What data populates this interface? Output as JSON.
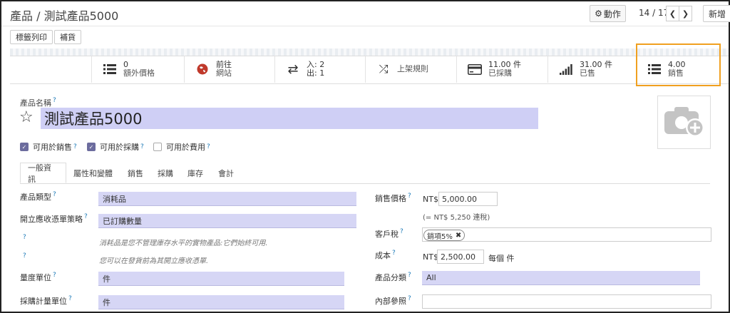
{
  "header": {
    "breadcrumb_root": "產品",
    "breadcrumb_sep": "/",
    "breadcrumb_current": "測試產品5000",
    "action_label": "動作",
    "pager": "14 / 17",
    "new_label": "新增"
  },
  "toolbar": {
    "print_labels": "標籤列印",
    "replenish": "補貨"
  },
  "smart_buttons": [
    {
      "icon": "list-icon",
      "line1": "0",
      "line2": "額外價格"
    },
    {
      "icon": "globe-icon",
      "line1": "前往",
      "line2": "網站"
    },
    {
      "icon": "transfer-icon",
      "line1": "入: 2",
      "line2": "出: 1"
    },
    {
      "icon": "shuffle-icon",
      "line1": "",
      "line2": "上架規則"
    },
    {
      "icon": "credit-card-icon",
      "line1": "11.00 件",
      "line2": "已採購"
    },
    {
      "icon": "signal-icon",
      "line1": "31.00 件",
      "line2": "已售"
    },
    {
      "icon": "list-icon",
      "line1": "4.00",
      "line2": "銷售"
    }
  ],
  "product": {
    "name_label": "產品名稱",
    "name_value": "測試產品5000",
    "can_be_sold": "可用於銷售",
    "can_be_purchased": "可用於採購",
    "can_be_expensed": "可用於費用"
  },
  "tabs": [
    "一般資訊",
    "屬性和變體",
    "銷售",
    "採購",
    "庫存",
    "會計"
  ],
  "left_fields": {
    "product_type_label": "產品類型",
    "product_type_value": "消耗品",
    "invoice_policy_label": "開立應收憑單策略",
    "invoice_policy_value": "已訂購數量",
    "hint1": "消耗品是您不管理庫存水平的實物產品:它們始終可用.",
    "hint2": "您可以在發貨前為其開立應收憑單.",
    "uom_label": "量度單位",
    "uom_value": "件",
    "purchase_uom_label": "採購計量單位",
    "purchase_uom_value": "件"
  },
  "right_fields": {
    "sales_price_label": "銷售價格",
    "currency": "NT$",
    "sales_price_value": "5,000.00",
    "tax_incl_note": "(= NT$ 5,250 連稅)",
    "customer_tax_label": "客戶稅",
    "customer_tax_tag": "銷項5%",
    "cost_label": "成本",
    "cost_value": "2,500.00",
    "cost_unit": "每個 件",
    "category_label": "產品分類",
    "category_value": "All",
    "internal_ref_label": "內部參照"
  },
  "colors": {
    "accent": "#6c6c9e",
    "field_bg": "#d6d6f5",
    "highlight": "#f0a020",
    "help": "#1e7bb8"
  }
}
